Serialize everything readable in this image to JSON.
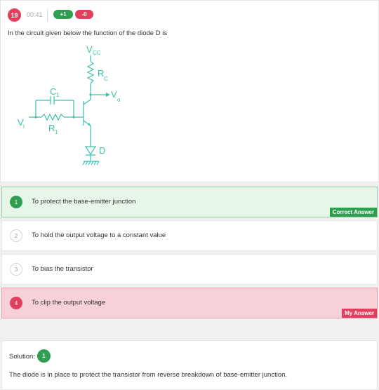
{
  "question": {
    "number": "19",
    "time": "00:41",
    "positive_marks": "+1",
    "negative_marks": "-0",
    "text": "In the circuit given below the function of the diode D is",
    "circuit_labels": {
      "vcc_main": "V",
      "vcc_sub": "CC",
      "rc_main": "R",
      "rc_sub": "C",
      "vo_main": "V",
      "vo_sub": "o",
      "c1_main": "C",
      "c1_sub": "1",
      "vi_main": "V",
      "vi_sub": "i",
      "r1_main": "R",
      "r1_sub": "1",
      "diode": "D"
    }
  },
  "options": [
    {
      "number": "1",
      "text": "To protect the base-emitter junction",
      "status": "correct",
      "tag": "Correct Answer"
    },
    {
      "number": "2",
      "text": "To hold the output voltage to a constant value",
      "status": "neutral",
      "tag": ""
    },
    {
      "number": "3",
      "text": "To bias the transistor",
      "status": "neutral",
      "tag": ""
    },
    {
      "number": "4",
      "text": "To clip the output voltage",
      "status": "wrong",
      "tag": "My Answer"
    }
  ],
  "solution": {
    "label": "Solution:",
    "answer_number": "1",
    "text": "The diode is in place to protect the transistor from reverse breakdown of base-emitter junction."
  },
  "colors": {
    "correct": "#2e9e4f",
    "wrong": "#e0405e",
    "circuit": "#3bbfae"
  }
}
